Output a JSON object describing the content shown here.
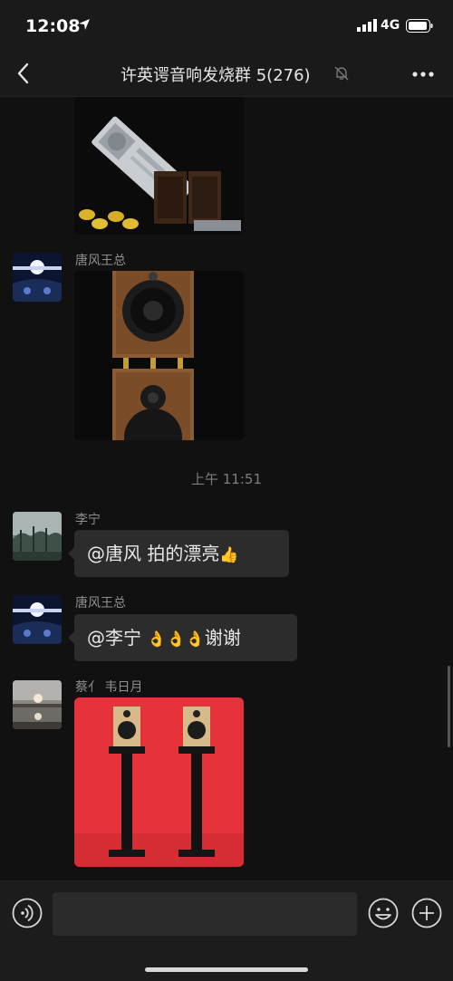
{
  "status_bar": {
    "time": "12:08",
    "network": "4G"
  },
  "header": {
    "title": "许英谔音响发烧群 5(276)"
  },
  "messages": [
    {
      "sender": "唐风王总"
    },
    {
      "timestamp": "上午 11:51"
    },
    {
      "sender": "李宁",
      "text": "@唐风 拍的漂亮",
      "emoji": "👍"
    },
    {
      "sender": "唐风王总",
      "text": "@李宁 ",
      "emoji": "👌👌👌",
      "suffix": "谢谢"
    },
    {
      "sender": "蔡亻 韦日月"
    }
  ],
  "icons": {
    "back": "chevron-left-icon",
    "mute": "bell-slash-icon",
    "more": "ellipsis-icon",
    "voice": "voice-icon",
    "emoji": "smile-icon",
    "plus": "plus-icon"
  }
}
